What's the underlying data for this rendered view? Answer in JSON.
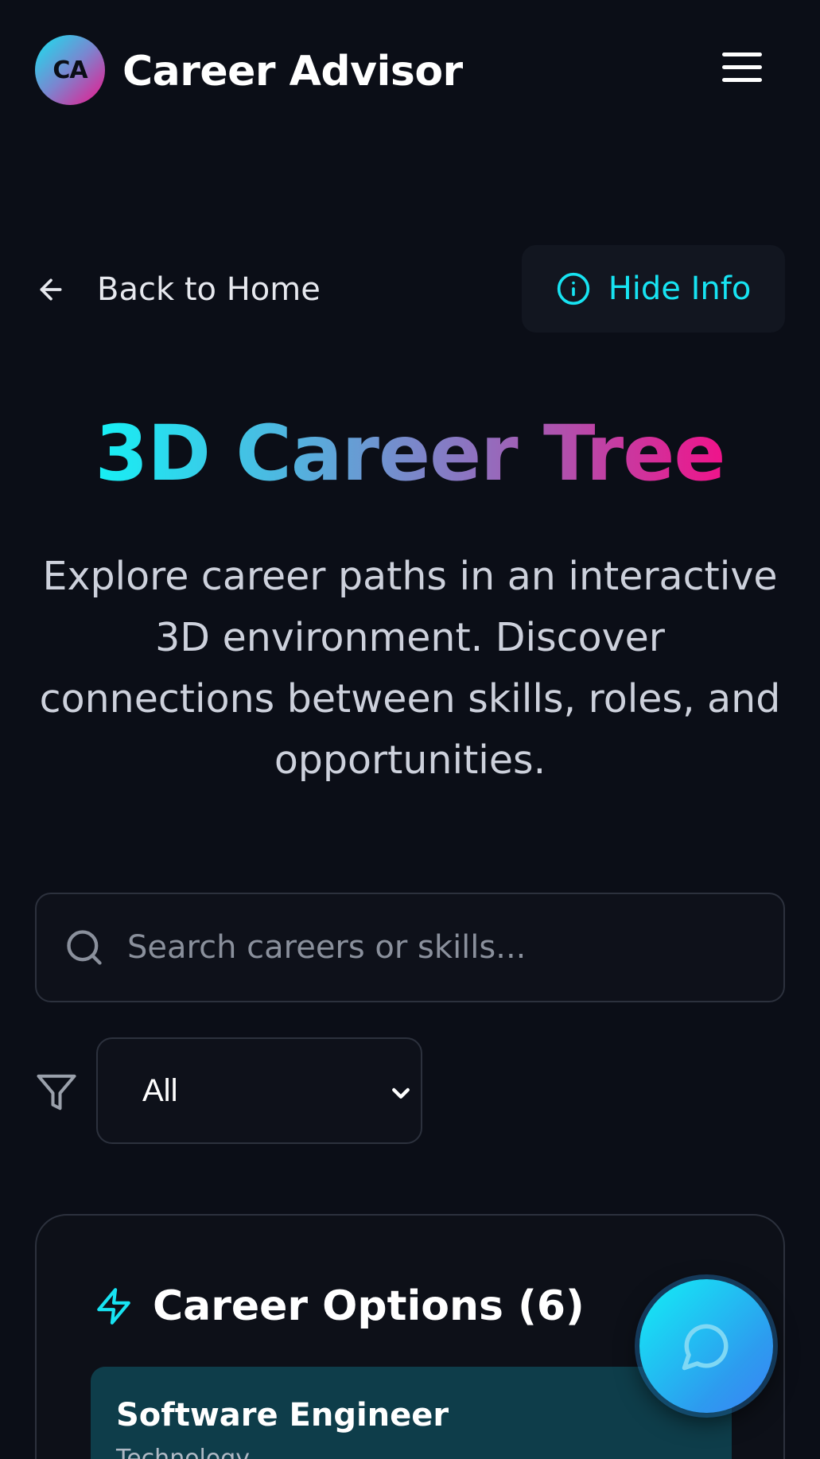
{
  "header": {
    "logo_text": "CA",
    "app_title": "Career Advisor",
    "menu_icon": "hamburger-menu-icon"
  },
  "actions": {
    "back_label": "Back to Home",
    "hide_info_label": "Hide Info"
  },
  "hero": {
    "title": "3D Career Tree",
    "subtitle": "Explore career paths in an interactive 3D environment. Discover connections between skills, roles, and opportunities."
  },
  "search": {
    "placeholder": "Search careers or skills...",
    "value": ""
  },
  "filter": {
    "selected": "All"
  },
  "career_options": {
    "title": "Career Options (6)",
    "items": [
      {
        "name": "Software Engineer",
        "category": "Technology"
      }
    ]
  },
  "colors": {
    "background": "#0b0e17",
    "accent_cyan": "#17e3f2",
    "accent_pink": "#f0138a",
    "card_item_bg": "#0e3d4a"
  }
}
